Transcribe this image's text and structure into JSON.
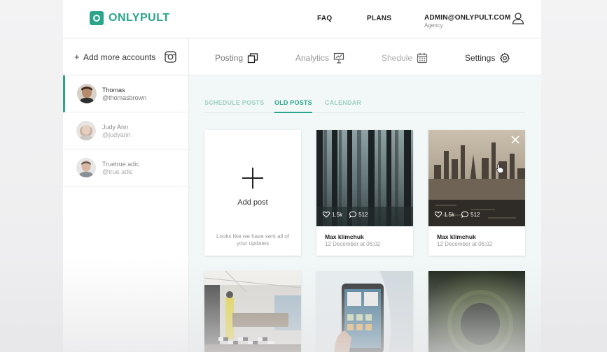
{
  "header": {
    "logo_text": "ONLYPULT",
    "nav": [
      "FAQ",
      "PLANS"
    ],
    "account_email": "ADMIN@ONLYPULT.COM",
    "account_role": "Agency"
  },
  "sidebar": {
    "add_label": "Add more accounts",
    "accounts": [
      {
        "name": "Thomas",
        "handle": "@thomasbrown"
      },
      {
        "name": "Judy Ann",
        "handle": "@judyann"
      },
      {
        "name": "Truetrue adic",
        "handle": "@true adic"
      }
    ]
  },
  "main_tabs": [
    "Posting",
    "Analytics",
    "Shedule",
    "Settings"
  ],
  "sub_tabs": [
    "SCHEDULE POSTS",
    "OLD POSTS",
    "CALENDAR"
  ],
  "add_card": {
    "label": "Add post",
    "note": "Looks like we have sent all of your updates"
  },
  "posts": [
    {
      "likes": "1.5k",
      "comments": "512",
      "author": "Max klimchuk",
      "date": "12 December at 06:02"
    },
    {
      "likes": "1.5k",
      "comments": "512",
      "author": "Max klimchuk",
      "date": "12 December at 06:02"
    }
  ],
  "colors": {
    "accent": "#2aa58a",
    "content_bg": "#f1f8f7"
  }
}
